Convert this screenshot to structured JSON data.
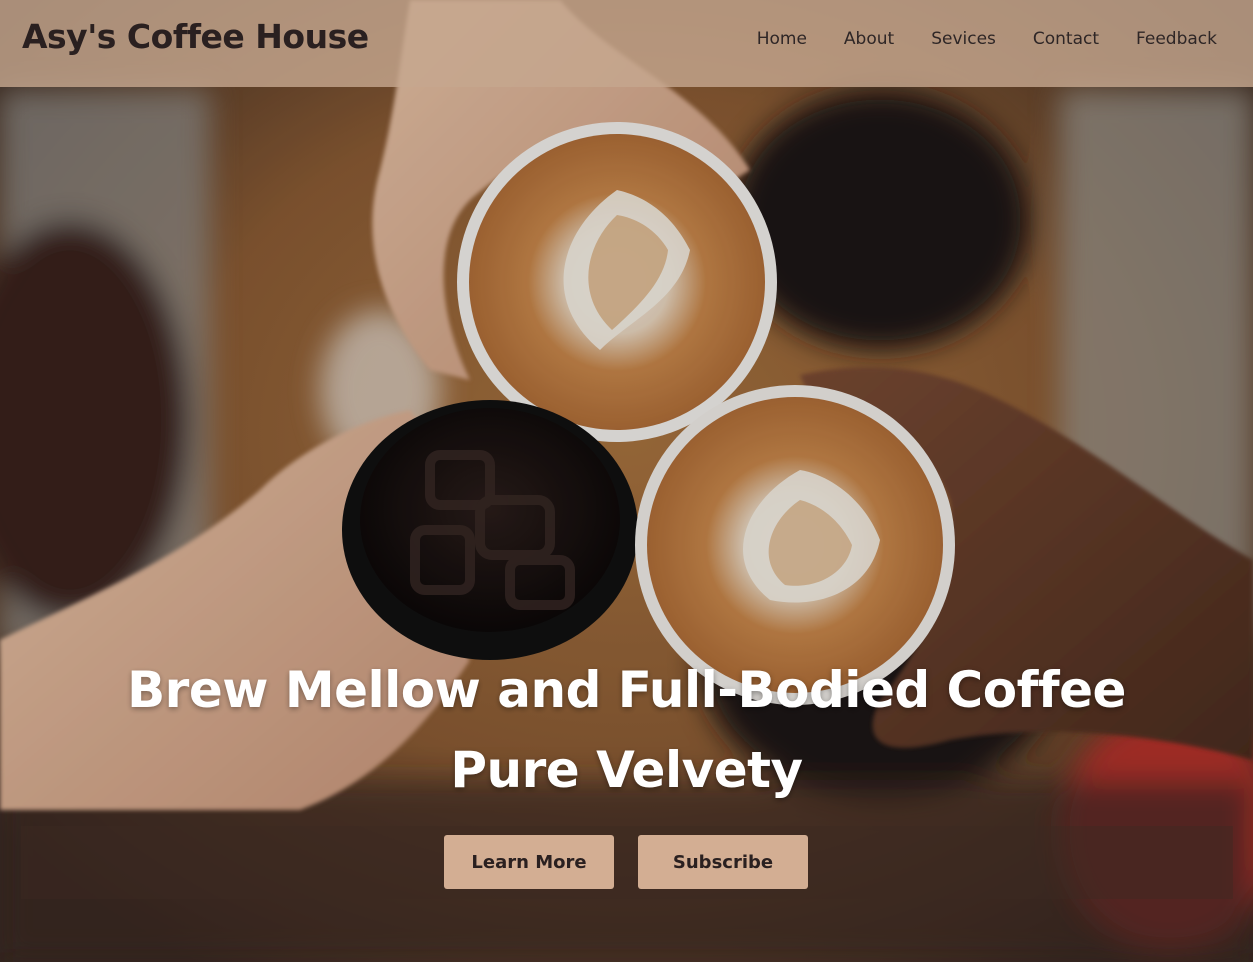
{
  "header": {
    "brand": "Asy's Coffee House",
    "nav": [
      {
        "label": "Home"
      },
      {
        "label": "About"
      },
      {
        "label": "Sevices"
      },
      {
        "label": "Contact"
      },
      {
        "label": "Feedback"
      }
    ]
  },
  "hero": {
    "headline_line1": "Brew Mellow and Full-Bodied Coffee",
    "headline_line2": "Pure Velvety",
    "buttons": {
      "learn_more": "Learn More",
      "subscribe": "Subscribe"
    }
  },
  "colors": {
    "header_bg": "#c4a68e",
    "button_bg": "#d3ae93",
    "button_text": "#2a2020",
    "headline_text": "#ffffff"
  }
}
